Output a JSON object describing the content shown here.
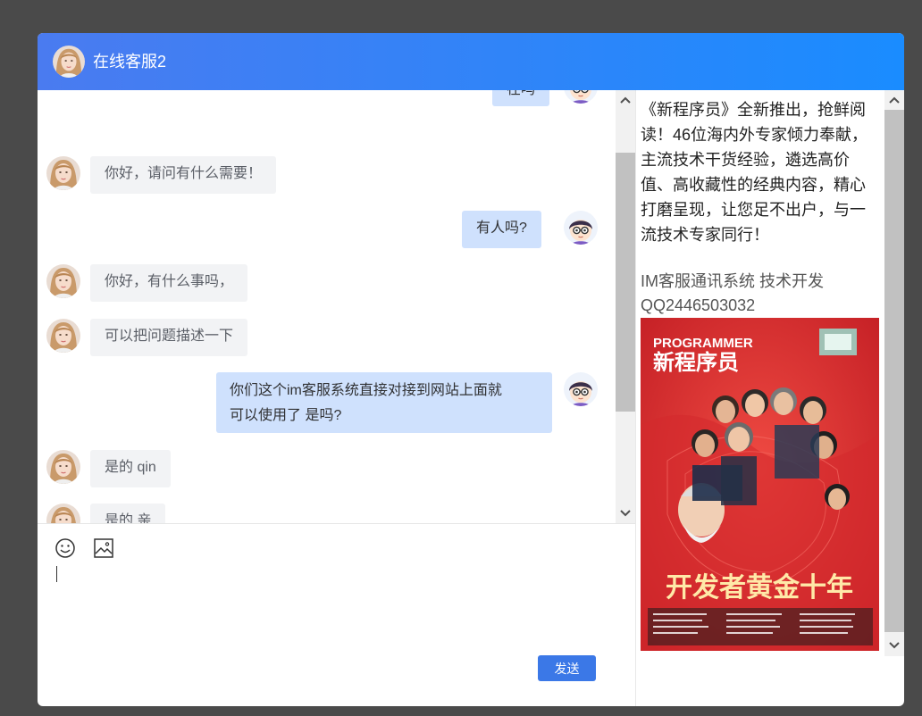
{
  "header": {
    "title": "在线客服2"
  },
  "messages": {
    "partial_top": "在吗",
    "m1": "你好，请问有什么需要！",
    "m2": "有人吗?",
    "m3": "你好，有什么事吗，",
    "m4": "可以把问题描述一下",
    "m5_line1": "你们这个im客服系统直接对接到网站上面就",
    "m5_line2": "可以使用了 是吗?",
    "m6": "是的 qin",
    "m7": "是的 亲"
  },
  "input": {
    "send_label": "发送"
  },
  "side": {
    "promo": "《新程序员》全新推出，抢鲜阅读！46位海内外专家倾力奉献，主流技术干货经验，遴选高价值、高收藏性的经典内容，精心打磨呈现，让您足不出户，与一流技术专家同行！",
    "contact_line1": "IM客服通讯系统 技术开发",
    "contact_line2": "QQ2446503032",
    "poster": {
      "brand": "PROGRAMMER",
      "title_cn": "新程序员",
      "headline": "开发者黄金十年"
    }
  },
  "colors": {
    "header_start": "#4a7bf0",
    "header_end": "#1a8cff",
    "bubble_self": "#cfe1fd",
    "bubble_other": "#f2f3f5",
    "send_button": "#3b78e7",
    "poster_red": "#d7262b"
  }
}
